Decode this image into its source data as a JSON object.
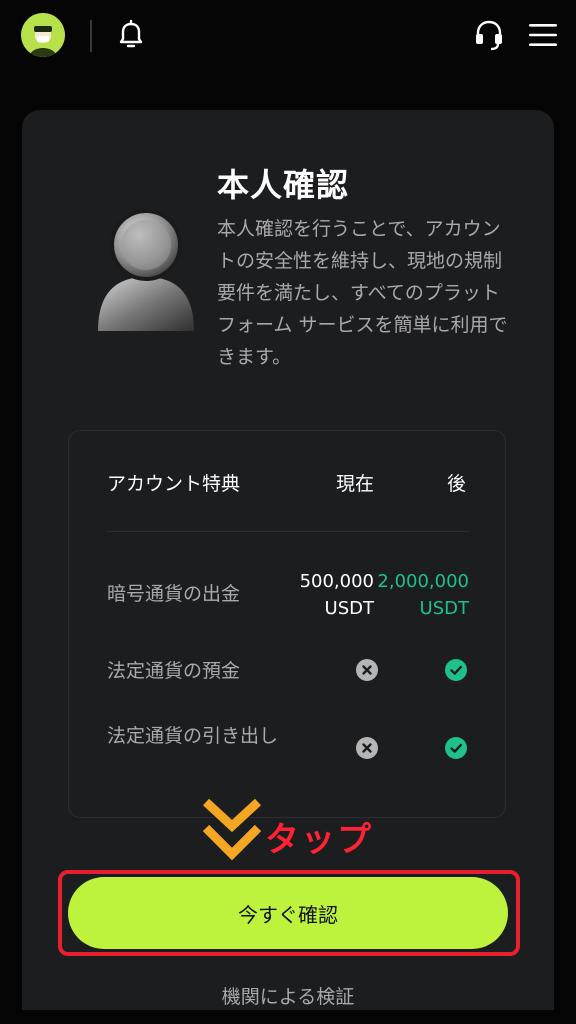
{
  "header": {
    "icons": [
      "avatar",
      "bell-icon",
      "headset-icon",
      "menu-icon"
    ]
  },
  "card": {
    "title": "本人確認",
    "description": "本人確認を行うことで、アカウントの安全性を維持し、現地の規制要件を満たし、すべてのプラットフォーム サービスを簡単に利用できます。"
  },
  "benefits": {
    "header": {
      "label": "アカウント特典",
      "now": "現在",
      "after": "後"
    },
    "rows": [
      {
        "label": "暗号通貨の出金",
        "now": "500,000\nUSDT",
        "after": "2,000,000\nUSDT"
      },
      {
        "label": "法定通貨の預金",
        "now_icon": "x-circle-icon",
        "after_icon": "check-circle-icon"
      },
      {
        "label": "法定通貨の引き出し",
        "now_icon": "x-circle-icon",
        "after_icon": "check-circle-icon"
      }
    ]
  },
  "annotation": {
    "tap_label": "タップ",
    "color": "#ff2233",
    "arrow_color": "#f5a623"
  },
  "cta": {
    "label": "今すぐ確認",
    "color": "#bdf33d"
  },
  "secondary_link": {
    "label": "機関による検証"
  },
  "colors": {
    "background": "#050505",
    "card": "#1c1d1f",
    "accent_green": "#1fc08a"
  }
}
